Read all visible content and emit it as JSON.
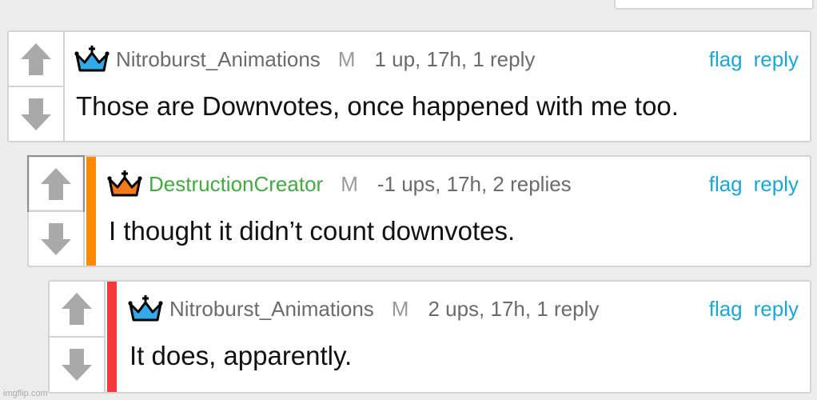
{
  "colors": {
    "link": "#1ba6d6",
    "username_green": "#43a940",
    "depth_orange": "#ff8a00",
    "depth_red": "#f23a3a",
    "crown_blue": "#33a9ea",
    "crown_orange": "#f27a1a"
  },
  "icons": {
    "upvote": "arrow-up-icon",
    "downvote": "arrow-down-icon",
    "badge": "crown-icon"
  },
  "comments": [
    {
      "username": "Nitroburst_Animations",
      "mod_badge": "M",
      "meta": "1 up, 17h, 1 reply",
      "flag_label": "flag",
      "reply_label": "reply",
      "text": "Those are Downvotes, once happened with me too."
    },
    {
      "username": "DestructionCreator",
      "mod_badge": "M",
      "meta": "-1 ups, 17h, 2 replies",
      "flag_label": "flag",
      "reply_label": "reply",
      "text": "I thought it didn’t count downvotes."
    },
    {
      "username": "Nitroburst_Animations",
      "mod_badge": "M",
      "meta": "2 ups, 17h, 1 reply",
      "flag_label": "flag",
      "reply_label": "reply",
      "text": "It does, apparently."
    }
  ],
  "watermark": "imgflip.com"
}
